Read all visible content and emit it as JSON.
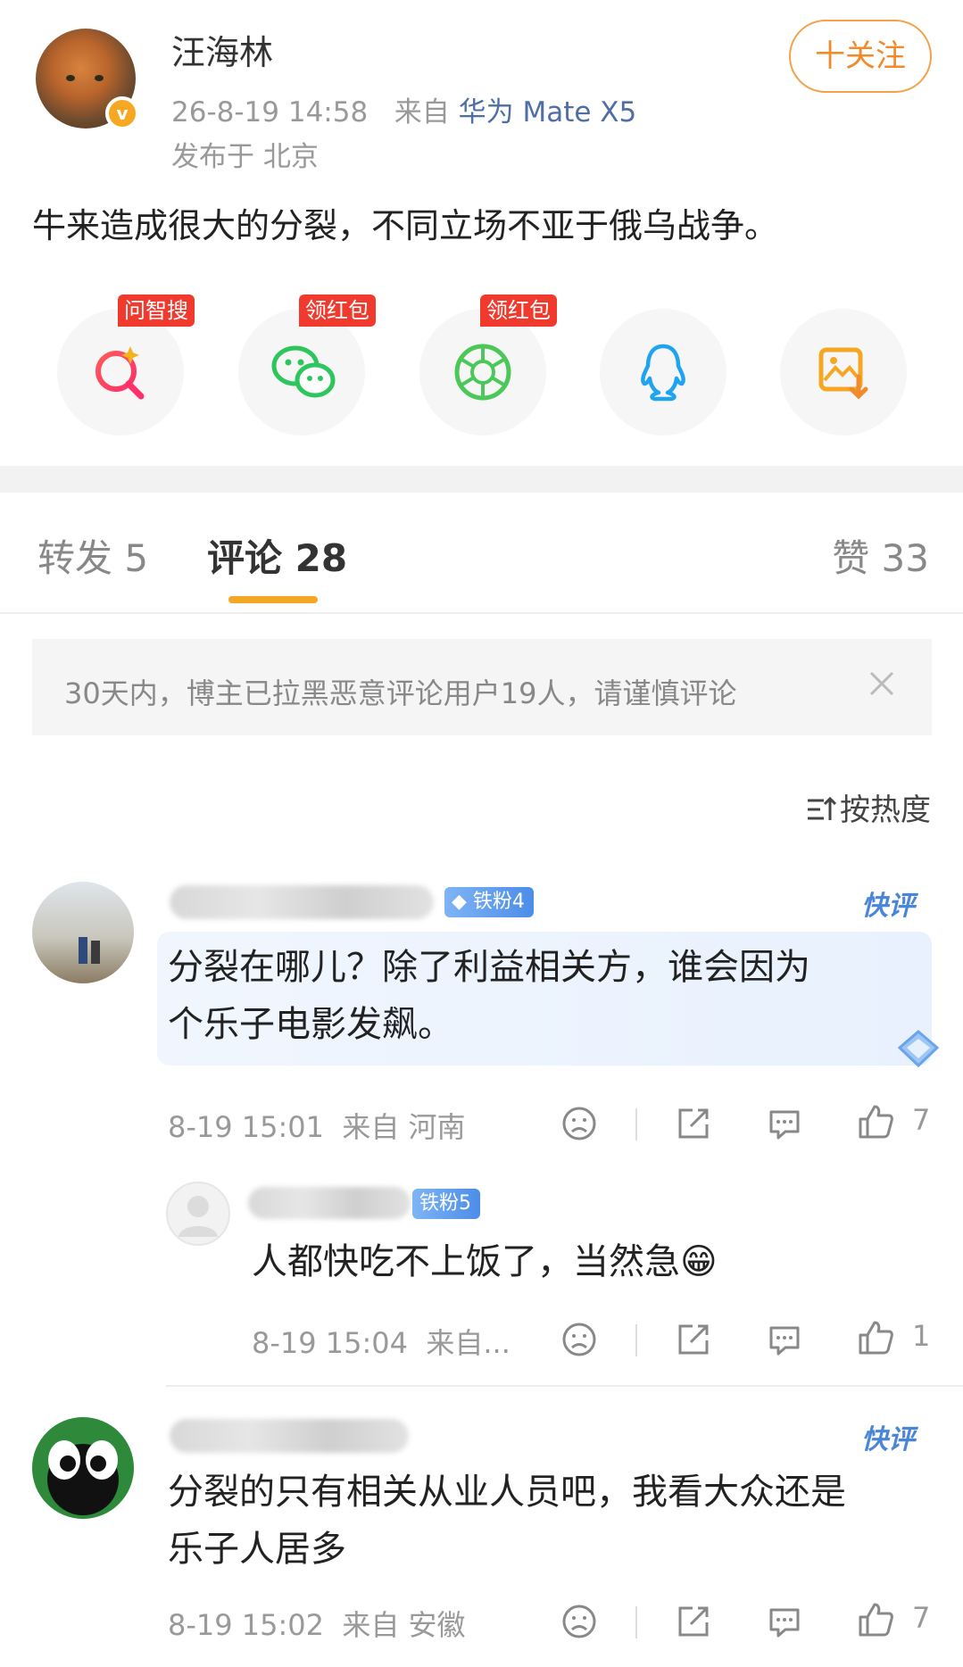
{
  "post": {
    "author": "汪海林",
    "time": "26-8-19 14:58",
    "source_prefix": "来自",
    "device": "华为 Mate X5",
    "location": "发布于 北京",
    "follow_label": "十关注",
    "text": "牛来造成很大的分裂，不同立场不亚于俄乌战争。"
  },
  "share": [
    {
      "icon": "search-ai-icon",
      "tag": "问智搜"
    },
    {
      "icon": "wechat-icon",
      "tag": "领红包"
    },
    {
      "icon": "moments-icon",
      "tag": "领红包"
    },
    {
      "icon": "qq-icon",
      "tag": ""
    },
    {
      "icon": "save-image-icon",
      "tag": ""
    }
  ],
  "tabs": {
    "repost": "转发 5",
    "comments": "评论 28",
    "likes": "赞 33"
  },
  "notice": "30天内，博主已拉黑恶意评论用户19人，请谨慎评论",
  "sort_label": "按热度",
  "comments": [
    {
      "fan_badge": "铁粉4",
      "quick_label": "快评",
      "text_line1": "分裂在哪儿？除了利益相关方，谁会因为",
      "text_line2": "个乐子电影发飙。",
      "time": "8-19 15:01",
      "location": "来自 河南",
      "likes": "7"
    },
    {
      "fan_badge": "铁粉5",
      "text": "人都快吃不上饭了，当然急😁",
      "time": "8-19 15:04",
      "location": "来自...",
      "likes": "1"
    },
    {
      "quick_label": "快评",
      "text_line1": "分裂的只有相关从业人员吧，我看大众还是",
      "text_line2": "乐子人居多",
      "time": "8-19 15:02",
      "location": "来自 安徽",
      "likes": "7"
    }
  ],
  "colors": {
    "accent_orange": "#f5a623",
    "link_blue": "#4e6ea6",
    "tag_red": "#f03a2e"
  }
}
